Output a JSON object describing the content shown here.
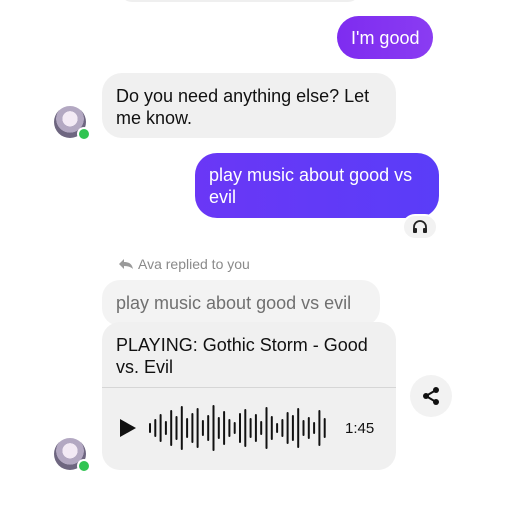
{
  "messages": {
    "out1": "I'm good",
    "in1": "Do you need anything else? Let me know.",
    "out2": "play music about good vs evil"
  },
  "reply": {
    "label": "Ava replied to you",
    "quote": "play music about good vs evil"
  },
  "player": {
    "title": "PLAYING: Gothic Storm - Good vs. Evil",
    "duration": "1:45"
  },
  "icons": {
    "reaction": "headphones-icon",
    "reply": "reply-arrow-icon",
    "play": "play-icon",
    "share": "share-icon"
  },
  "colors": {
    "outgoing_bubble_1": "#8234f1",
    "outgoing_bubble_2": "#623af7",
    "incoming_bubble": "#f0f0f0",
    "online_dot": "#31c452"
  }
}
